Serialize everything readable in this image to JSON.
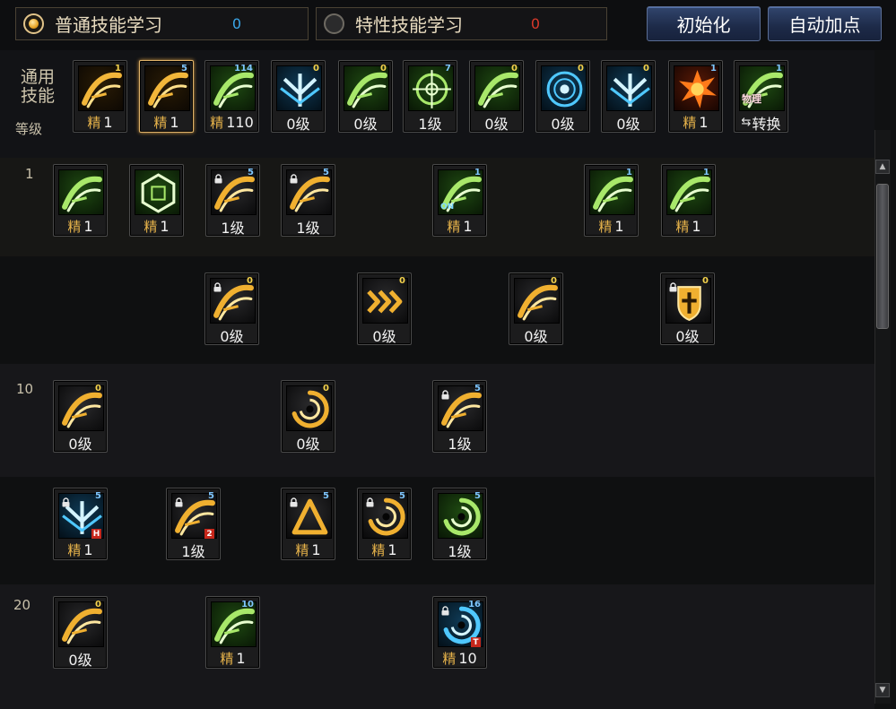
{
  "tabs": {
    "normal": {
      "label": "普通技能学习",
      "points": "0",
      "selected": true
    },
    "trait": {
      "label": "特性技能学习",
      "points": "0",
      "selected": false
    }
  },
  "buttons": {
    "reset": "初始化",
    "auto": "自动加点"
  },
  "general": {
    "title": "通用\n技能",
    "level_label": "等级"
  },
  "row_levels": {
    "r1": "1",
    "r10": "10",
    "r20": "20"
  },
  "colors": {
    "rank_gold": "#e7b34a",
    "badge_gold": "#f3d14c",
    "badge_blue": "#7fc7ff",
    "points_blue": "#3aa6e8",
    "points_red": "#d8382a"
  },
  "general_skills": [
    {
      "icon": "crouch-sprint-icon",
      "rank": "精",
      "level": "1",
      "badge": "1",
      "badge_color": "gold"
    },
    {
      "icon": "crouch-timer-icon",
      "rank": "精",
      "level": "1",
      "badge": "5",
      "badge_color": "blue"
    },
    {
      "icon": "leap-kick-icon",
      "rank": "精",
      "level": "110",
      "badge": "114",
      "badge_color": "blue"
    },
    {
      "icon": "winged-arrow-icon",
      "rank": "",
      "level": "0级",
      "badge": "0",
      "badge_color": "gold"
    },
    {
      "icon": "dash-runner-icon",
      "rank": "",
      "level": "0级",
      "badge": "0",
      "badge_color": "gold"
    },
    {
      "icon": "crosshair-icon",
      "rank": "",
      "level": "1级",
      "badge": "7",
      "badge_color": "blue"
    },
    {
      "icon": "shout-icon",
      "rank": "",
      "level": "0级",
      "badge": "0",
      "badge_color": "gold"
    },
    {
      "icon": "eye-ring-icon",
      "rank": "",
      "level": "0级",
      "badge": "0",
      "badge_color": "gold"
    },
    {
      "icon": "body-aura-icon",
      "rank": "",
      "level": "0级",
      "badge": "0",
      "badge_color": "gold"
    },
    {
      "icon": "explosion-icon",
      "rank": "精",
      "level": "1",
      "badge": "1",
      "badge_color": "blue"
    },
    {
      "icon": "physical-convert-icon",
      "rank": "",
      "level": "转换",
      "badge": "1",
      "badge_color": "blue",
      "icon_text": "物理"
    }
  ],
  "skill_rows": [
    [
      {
        "icon": "rain-leaves-icon",
        "rank": "精",
        "level": "1",
        "badge": "",
        "badge_color": ""
      },
      {
        "icon": "hex-rune-icon",
        "rank": "精",
        "level": "1",
        "badge": "",
        "badge_color": ""
      },
      {
        "icon": "gold-sweep-icon",
        "rank": "",
        "level": "1级",
        "badge": "5",
        "badge_color": "blue",
        "locked": true
      },
      {
        "icon": "gold-arc-icon",
        "rank": "",
        "level": "1级",
        "badge": "5",
        "badge_color": "blue",
        "locked": true
      },
      {
        "icon": "splash-on-icon",
        "rank": "精",
        "level": "1",
        "badge": "1",
        "badge_color": "blue",
        "on": "ON"
      },
      {
        "icon": "green-slash-icon",
        "rank": "精",
        "level": "1",
        "badge": "1",
        "badge_color": "blue"
      },
      {
        "icon": "green-blade-icon",
        "rank": "精",
        "level": "1",
        "badge": "1",
        "badge_color": "blue"
      }
    ],
    [
      {
        "icon": "burst-claw-icon",
        "rank": "",
        "level": "0级",
        "badge": "0",
        "badge_color": "gold",
        "locked": true
      },
      {
        "icon": "triple-chevron-icon",
        "rank": "",
        "level": "0级",
        "badge": "0",
        "badge_color": "gold"
      },
      {
        "icon": "ground-slam-icon",
        "rank": "",
        "level": "0级",
        "badge": "0",
        "badge_color": "gold"
      },
      {
        "icon": "shield-cross-icon",
        "rank": "",
        "level": "0级",
        "badge": "0",
        "badge_color": "gold",
        "locked": true
      }
    ],
    [
      {
        "icon": "lightning-dash-icon",
        "rank": "",
        "level": "0级",
        "badge": "0",
        "badge_color": "gold"
      },
      {
        "icon": "vortex-icon",
        "rank": "",
        "level": "0级",
        "badge": "0",
        "badge_color": "gold"
      },
      {
        "icon": "phoenix-icon",
        "rank": "",
        "level": "1级",
        "badge": "5",
        "badge_color": "blue",
        "locked": true
      }
    ],
    [
      {
        "icon": "ice-cross-icon",
        "rank": "精",
        "level": "1",
        "badge": "5",
        "badge_color": "blue",
        "locked": true,
        "corner": "H"
      },
      {
        "icon": "gold-comet-icon",
        "rank": "",
        "level": "1级",
        "badge": "5",
        "badge_color": "blue",
        "locked": true,
        "corner": "2"
      },
      {
        "icon": "gold-triangle-icon",
        "rank": "精",
        "level": "1",
        "badge": "5",
        "badge_color": "blue",
        "locked": true
      },
      {
        "icon": "gold-ring-icon",
        "rank": "精",
        "level": "1",
        "badge": "5",
        "badge_color": "blue",
        "locked": true
      },
      {
        "icon": "green-cyclone-icon",
        "rank": "",
        "level": "1级",
        "badge": "5",
        "badge_color": "blue"
      }
    ],
    [
      {
        "icon": "gold-fan-icon",
        "rank": "",
        "level": "0级",
        "badge": "0",
        "badge_color": "gold"
      },
      {
        "icon": "green-blossom-icon",
        "rank": "精",
        "level": "1",
        "badge": "10",
        "badge_color": "blue"
      },
      {
        "icon": "blue-orbit-icon",
        "rank": "精",
        "level": "10",
        "badge": "16",
        "badge_color": "blue",
        "locked": true,
        "corner": "T"
      }
    ]
  ]
}
